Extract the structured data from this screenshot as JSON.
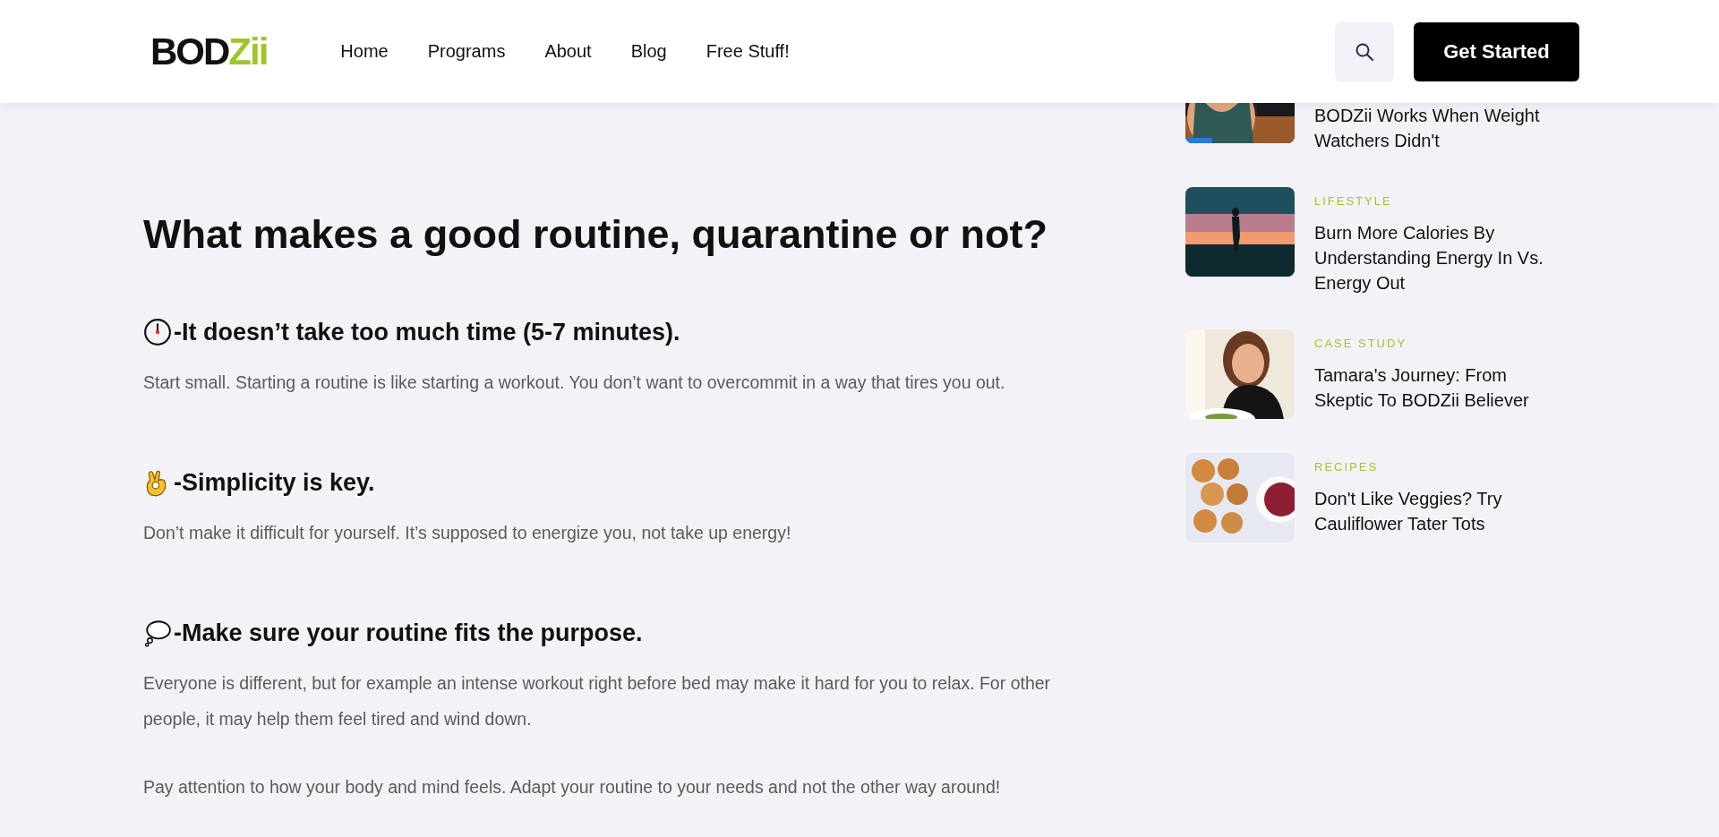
{
  "header": {
    "logo": {
      "dark": "BOD",
      "accent": "Zii"
    },
    "nav": [
      {
        "label": "Home"
      },
      {
        "label": "Programs"
      },
      {
        "label": "About"
      },
      {
        "label": "Blog"
      },
      {
        "label": "Free Stuff!"
      }
    ],
    "cta": "Get Started"
  },
  "article": {
    "title": "What makes a good routine, quarantine or not?",
    "sections": [
      {
        "kind": "clock",
        "heading": "-It doesn’t take too much time (5-7 minutes).",
        "paragraphs": [
          "Start small. Starting a routine is like starting a workout. You don’t want to overcommit in a way that tires you out."
        ]
      },
      {
        "kind": "ok-hand",
        "heading": "-Simplicity is key.",
        "paragraphs": [
          "Don’t make it difficult for yourself. It’s supposed to energize you, not take up energy!"
        ]
      },
      {
        "kind": "thought",
        "heading": "-Make sure your routine fits the purpose.",
        "paragraphs": [
          "Everyone is different, but for example an intense workout right before bed may make it hard for you to relax. For other people, it may help them feel tired and wind down.",
          "Pay attention to how your body and mind feels. Adapt your routine to your needs and not the other way around!"
        ]
      }
    ]
  },
  "sidebar": {
    "posts": [
      {
        "title": "BODZii Works When Weight Watchers Didn't"
      },
      {
        "category": "LIFESTYLE",
        "title": "Burn More Calories By Understanding Energy In Vs. Energy Out"
      },
      {
        "category": "CASE STUDY",
        "title": "Tamara's Journey: From Skeptic To BODZii Believer"
      },
      {
        "category": "RECIPES",
        "title": "Don't Like Veggies? Try Cauliflower Tater Tots"
      }
    ]
  }
}
